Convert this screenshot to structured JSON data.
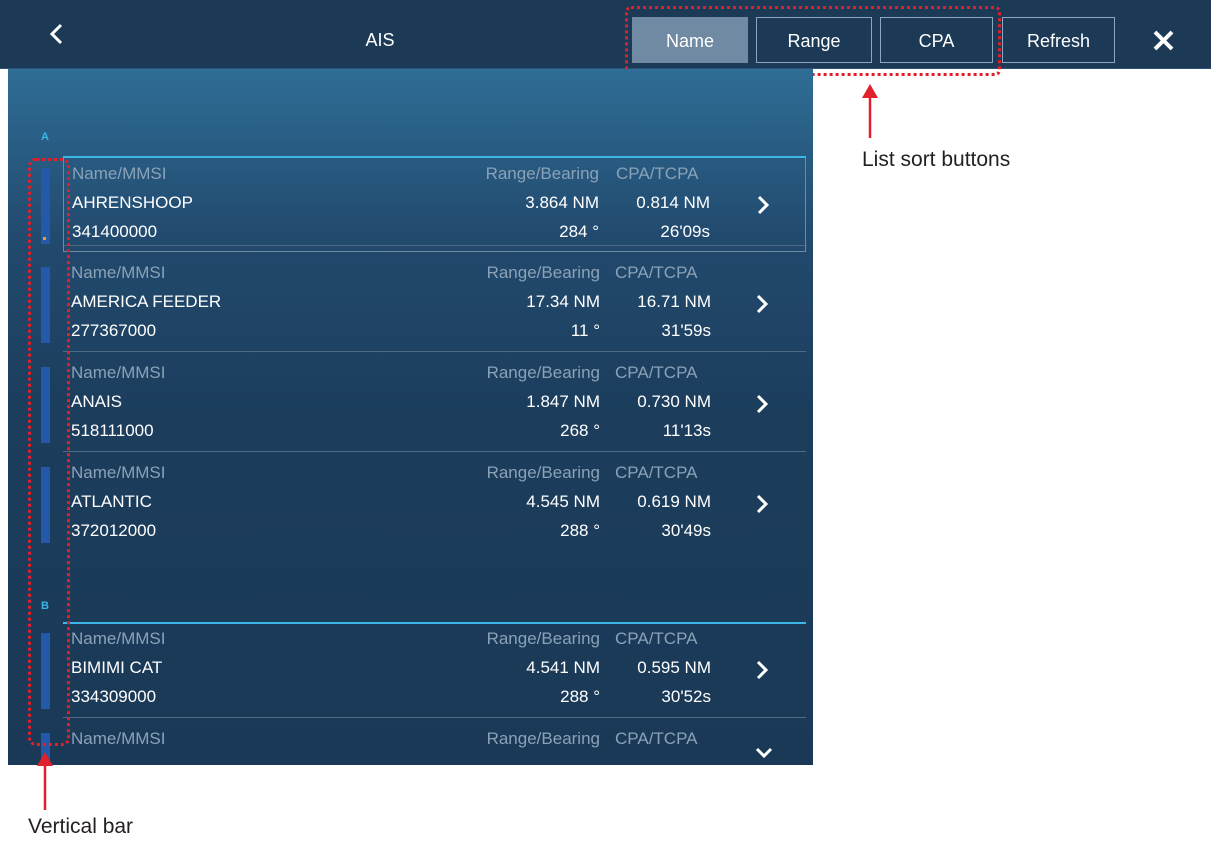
{
  "header": {
    "title": "AIS",
    "sort_buttons": [
      "Name",
      "Range",
      "CPA"
    ],
    "refresh_label": "Refresh",
    "active_sort": "Name",
    "icons": {
      "back": "chevron-left-icon",
      "close": "close-icon"
    }
  },
  "list": {
    "sections": [
      {
        "letter": "A",
        "items": [
          {
            "label_name": "Name/MMSI",
            "label_range": "Range/Bearing",
            "label_cpa": "CPA/TCPA",
            "name": "AHRENSHOOP",
            "mmsi": "341400000",
            "range": "3.864 NM",
            "bearing": "284 °",
            "cpa": "0.814 NM",
            "tcpa": "26'09s"
          },
          {
            "label_name": "Name/MMSI",
            "label_range": "Range/Bearing",
            "label_cpa": "CPA/TCPA",
            "name": "AMERICA FEEDER",
            "mmsi": "277367000",
            "range": "17.34 NM",
            "bearing": "11 °",
            "cpa": "16.71 NM",
            "tcpa": "31'59s"
          },
          {
            "label_name": "Name/MMSI",
            "label_range": "Range/Bearing",
            "label_cpa": "CPA/TCPA",
            "name": "ANAIS",
            "mmsi": "518111000",
            "range": "1.847 NM",
            "bearing": "268 °",
            "cpa": "0.730 NM",
            "tcpa": "11'13s"
          },
          {
            "label_name": "Name/MMSI",
            "label_range": "Range/Bearing",
            "label_cpa": "CPA/TCPA",
            "name": "ATLANTIC",
            "mmsi": "372012000",
            "range": "4.545 NM",
            "bearing": "288 °",
            "cpa": "0.619 NM",
            "tcpa": "30'49s"
          }
        ]
      },
      {
        "letter": "B",
        "items": [
          {
            "label_name": "Name/MMSI",
            "label_range": "Range/Bearing",
            "label_cpa": "CPA/TCPA",
            "name": "BIMIMI CAT",
            "mmsi": "334309000",
            "range": "4.541 NM",
            "bearing": "288 °",
            "cpa": "0.595 NM",
            "tcpa": "30'52s"
          },
          {
            "label_name": "Name/MMSI",
            "label_range": "Range/Bearing",
            "label_cpa": "CPA/TCPA"
          }
        ]
      }
    ]
  },
  "annotations": {
    "sort_buttons_label": "List sort buttons",
    "vertical_bar_label": "Vertical bar"
  },
  "colors": {
    "header_bg": "#1c3a56",
    "section_accent": "#3cb5e8",
    "vertical_bar": "#2458a8",
    "annotation_red": "#e0202a",
    "active_button": "#6f8aa2"
  }
}
